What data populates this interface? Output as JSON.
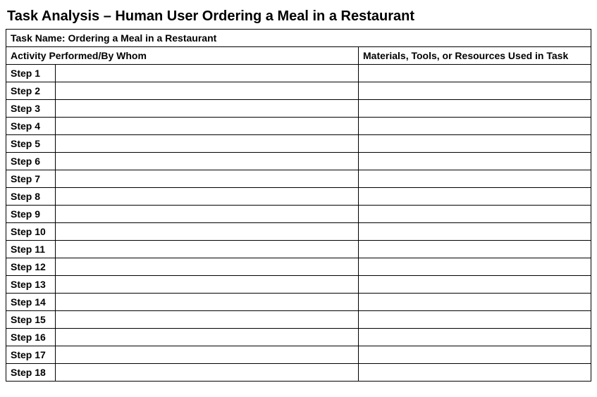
{
  "title": "Task Analysis – Human User Ordering a Meal in a Restaurant",
  "task_name_row": "Task Name: Ordering a Meal in a Restaurant",
  "headers": {
    "activity": "Activity Performed/By Whom",
    "materials": "Materials, Tools, or Resources Used in Task"
  },
  "steps": [
    {
      "label": "Step 1",
      "activity": "",
      "materials": ""
    },
    {
      "label": "Step 2",
      "activity": "",
      "materials": ""
    },
    {
      "label": "Step 3",
      "activity": "",
      "materials": ""
    },
    {
      "label": "Step 4",
      "activity": "",
      "materials": ""
    },
    {
      "label": "Step 5",
      "activity": "",
      "materials": ""
    },
    {
      "label": "Step 6",
      "activity": "",
      "materials": ""
    },
    {
      "label": "Step 7",
      "activity": "",
      "materials": ""
    },
    {
      "label": "Step 8",
      "activity": "",
      "materials": ""
    },
    {
      "label": "Step 9",
      "activity": "",
      "materials": ""
    },
    {
      "label": "Step 10",
      "activity": "",
      "materials": ""
    },
    {
      "label": "Step 11",
      "activity": "",
      "materials": ""
    },
    {
      "label": "Step 12",
      "activity": "",
      "materials": ""
    },
    {
      "label": "Step 13",
      "activity": "",
      "materials": ""
    },
    {
      "label": "Step 14",
      "activity": "",
      "materials": ""
    },
    {
      "label": "Step 15",
      "activity": "",
      "materials": ""
    },
    {
      "label": "Step 16",
      "activity": "",
      "materials": ""
    },
    {
      "label": "Step 17",
      "activity": "",
      "materials": ""
    },
    {
      "label": "Step 18",
      "activity": "",
      "materials": ""
    }
  ]
}
